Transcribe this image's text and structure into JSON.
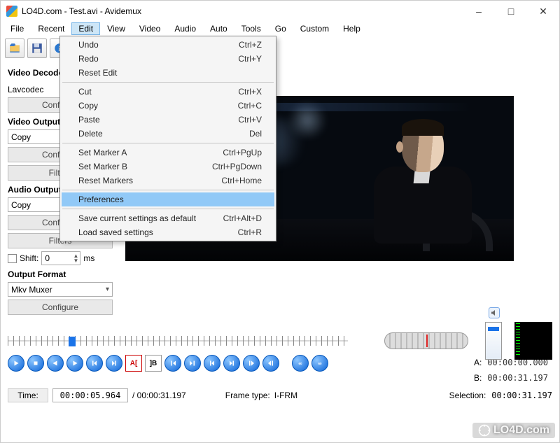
{
  "window": {
    "title": "LO4D.com - Test.avi - Avidemux"
  },
  "menubar": [
    "File",
    "Recent",
    "Edit",
    "View",
    "Video",
    "Audio",
    "Auto",
    "Tools",
    "Go",
    "Custom",
    "Help"
  ],
  "menubar_active": "Edit",
  "edit_menu": [
    {
      "label": "Undo",
      "shortcut": "Ctrl+Z",
      "type": "item"
    },
    {
      "label": "Redo",
      "shortcut": "Ctrl+Y",
      "type": "item"
    },
    {
      "label": "Reset Edit",
      "shortcut": "",
      "type": "item"
    },
    {
      "type": "sep"
    },
    {
      "label": "Cut",
      "shortcut": "Ctrl+X",
      "type": "item"
    },
    {
      "label": "Copy",
      "shortcut": "Ctrl+C",
      "type": "item"
    },
    {
      "label": "Paste",
      "shortcut": "Ctrl+V",
      "type": "item"
    },
    {
      "label": "Delete",
      "shortcut": "Del",
      "type": "item"
    },
    {
      "type": "sep"
    },
    {
      "label": "Set Marker A",
      "shortcut": "Ctrl+PgUp",
      "type": "item"
    },
    {
      "label": "Set Marker B",
      "shortcut": "Ctrl+PgDown",
      "type": "item"
    },
    {
      "label": "Reset Markers",
      "shortcut": "Ctrl+Home",
      "type": "item"
    },
    {
      "type": "sep"
    },
    {
      "label": "Preferences",
      "shortcut": "",
      "type": "item",
      "highlight": true
    },
    {
      "type": "sep"
    },
    {
      "label": "Save current settings as default",
      "shortcut": "Ctrl+Alt+D",
      "type": "item"
    },
    {
      "label": "Load saved settings",
      "shortcut": "Ctrl+R",
      "type": "item"
    }
  ],
  "sidebar": {
    "video_decoder_label": "Video Decoder",
    "video_decoder_value": "Lavcodec",
    "configure": "Configure",
    "video_output_label": "Video Output",
    "video_output_value": "Copy",
    "filters": "Filters",
    "audio_output_label": "Audio Output",
    "audio_output_value": "Copy",
    "shift_label": "Shift:",
    "shift_value": "0",
    "shift_unit": "ms",
    "output_format_label": "Output Format",
    "output_format_value": "Mkv Muxer"
  },
  "timeline": {
    "time_label": "Time:",
    "time_value": "00:00:05.964",
    "duration": "/ 00:00:31.197",
    "frametype_label": "Frame type:",
    "frametype_value": "I-FRM",
    "a_label": "A:",
    "a_value": "00:00:00.000",
    "b_label": "B:",
    "b_value": "00:00:31.197",
    "selection_label": "Selection:",
    "selection_value": "00:00:31.197"
  },
  "watermark": "LO4D.com"
}
